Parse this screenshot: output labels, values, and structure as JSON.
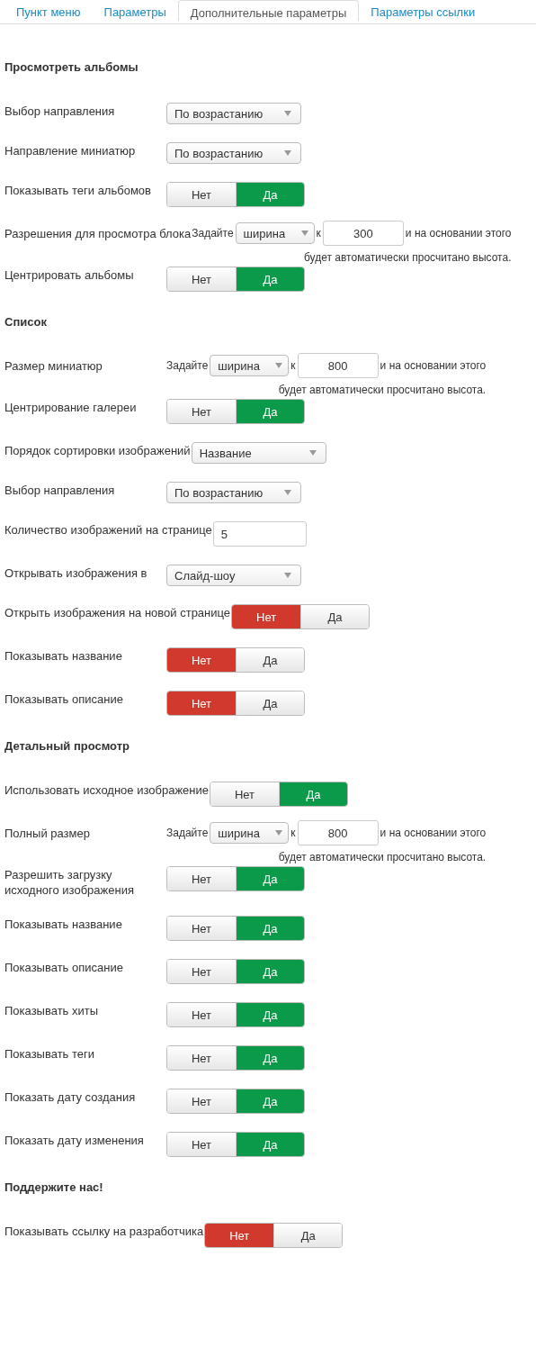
{
  "tabs": [
    {
      "label": "Пункт меню",
      "selected": false
    },
    {
      "label": "Параметры",
      "selected": false
    },
    {
      "label": "Дополнительные параметры",
      "selected": true
    },
    {
      "label": "Параметры ссылки",
      "selected": false
    }
  ],
  "sections": [
    {
      "title": "Просмотреть альбомы",
      "rows": [
        {
          "kind": "select",
          "label": "Выбор направления",
          "value": "По возрастанию"
        },
        {
          "kind": "select",
          "label": "Направление миниатюр",
          "value": "По возрастанию"
        },
        {
          "kind": "toggle",
          "label": "Показывать теги альбомов",
          "options": [
            {
              "label": "Нет",
              "selected": false
            },
            {
              "label": "Да",
              "selected": true,
              "color": "#0a9a4a"
            }
          ]
        },
        {
          "kind": "dimension",
          "label": "Разрешения для просмотра блока",
          "prefix": "Задайте",
          "select": "ширина",
          "joiner": "к",
          "value": "300",
          "suffix": "и на основании этого",
          "note": "будет автоматически просчитано высота."
        },
        {
          "kind": "toggle",
          "label": "Центрировать альбомы",
          "options": [
            {
              "label": "Нет",
              "selected": false
            },
            {
              "label": "Да",
              "selected": true,
              "color": "#0a9a4a"
            }
          ]
        }
      ]
    },
    {
      "title": "Список",
      "rows": [
        {
          "kind": "dimension",
          "label": "Размер миниатюр",
          "prefix": "Задайте",
          "select": "ширина",
          "joiner": "к",
          "value": "800",
          "suffix": "и на основании этого",
          "note": "будет автоматически просчитано высота."
        },
        {
          "kind": "toggle",
          "label": "Центрирование галереи",
          "options": [
            {
              "label": "Нет",
              "selected": false
            },
            {
              "label": "Да",
              "selected": true,
              "color": "#0a9a4a"
            }
          ]
        },
        {
          "kind": "select",
          "label": "Порядок сортировки изображений",
          "value": "Название"
        },
        {
          "kind": "select",
          "label": "Выбор направления",
          "value": "По возрастанию"
        },
        {
          "kind": "text",
          "label": "Количество изображений на странице",
          "value": "5"
        },
        {
          "kind": "select",
          "label": "Открывать изображения в",
          "value": "Слайд-шоу"
        },
        {
          "kind": "toggle",
          "label": "Открыть изображения на новой странице",
          "options": [
            {
              "label": "Нет",
              "selected": true,
              "color": "#d0392b"
            },
            {
              "label": "Да",
              "selected": false
            }
          ]
        },
        {
          "kind": "toggle",
          "label": "Показывать название",
          "options": [
            {
              "label": "Нет",
              "selected": true,
              "color": "#d0392b"
            },
            {
              "label": "Да",
              "selected": false
            }
          ]
        },
        {
          "kind": "toggle",
          "label": "Показывать описание",
          "options": [
            {
              "label": "Нет",
              "selected": true,
              "color": "#d0392b"
            },
            {
              "label": "Да",
              "selected": false
            }
          ]
        }
      ]
    },
    {
      "title": "Детальный просмотр",
      "rows": [
        {
          "kind": "toggle",
          "label": "Использовать исходное изображение",
          "options": [
            {
              "label": "Нет",
              "selected": false
            },
            {
              "label": "Да",
              "selected": true,
              "color": "#0a9a4a"
            }
          ]
        },
        {
          "kind": "dimension",
          "label": "Полный размер",
          "prefix": "Задайте",
          "select": "ширина",
          "joiner": "к",
          "value": "800",
          "suffix": "и на основании этого",
          "note": "будет автоматически просчитано высота."
        },
        {
          "kind": "toggle",
          "label": "Разрешить загрузку\nисходного изображения",
          "options": [
            {
              "label": "Нет",
              "selected": false
            },
            {
              "label": "Да",
              "selected": true,
              "color": "#0a9a4a"
            }
          ]
        },
        {
          "kind": "toggle",
          "label": "Показывать название",
          "options": [
            {
              "label": "Нет",
              "selected": false
            },
            {
              "label": "Да",
              "selected": true,
              "color": "#0a9a4a"
            }
          ]
        },
        {
          "kind": "toggle",
          "label": "Показывать описание",
          "options": [
            {
              "label": "Нет",
              "selected": false
            },
            {
              "label": "Да",
              "selected": true,
              "color": "#0a9a4a"
            }
          ]
        },
        {
          "kind": "toggle",
          "label": "Показывать хиты",
          "options": [
            {
              "label": "Нет",
              "selected": false
            },
            {
              "label": "Да",
              "selected": true,
              "color": "#0a9a4a"
            }
          ]
        },
        {
          "kind": "toggle",
          "label": "Показывать теги",
          "options": [
            {
              "label": "Нет",
              "selected": false
            },
            {
              "label": "Да",
              "selected": true,
              "color": "#0a9a4a"
            }
          ]
        },
        {
          "kind": "toggle",
          "label": "Показать дату создания",
          "options": [
            {
              "label": "Нет",
              "selected": false
            },
            {
              "label": "Да",
              "selected": true,
              "color": "#0a9a4a"
            }
          ]
        },
        {
          "kind": "toggle",
          "label": "Показать дату изменения",
          "options": [
            {
              "label": "Нет",
              "selected": false
            },
            {
              "label": "Да",
              "selected": true,
              "color": "#0a9a4a"
            }
          ]
        }
      ]
    },
    {
      "title": "Поддержите нас!",
      "rows": [
        {
          "kind": "toggle",
          "label": "Показывать ссылку на разработчика",
          "options": [
            {
              "label": "Нет",
              "selected": true,
              "color": "#d0392b"
            },
            {
              "label": "Да",
              "selected": false
            }
          ]
        }
      ]
    }
  ]
}
